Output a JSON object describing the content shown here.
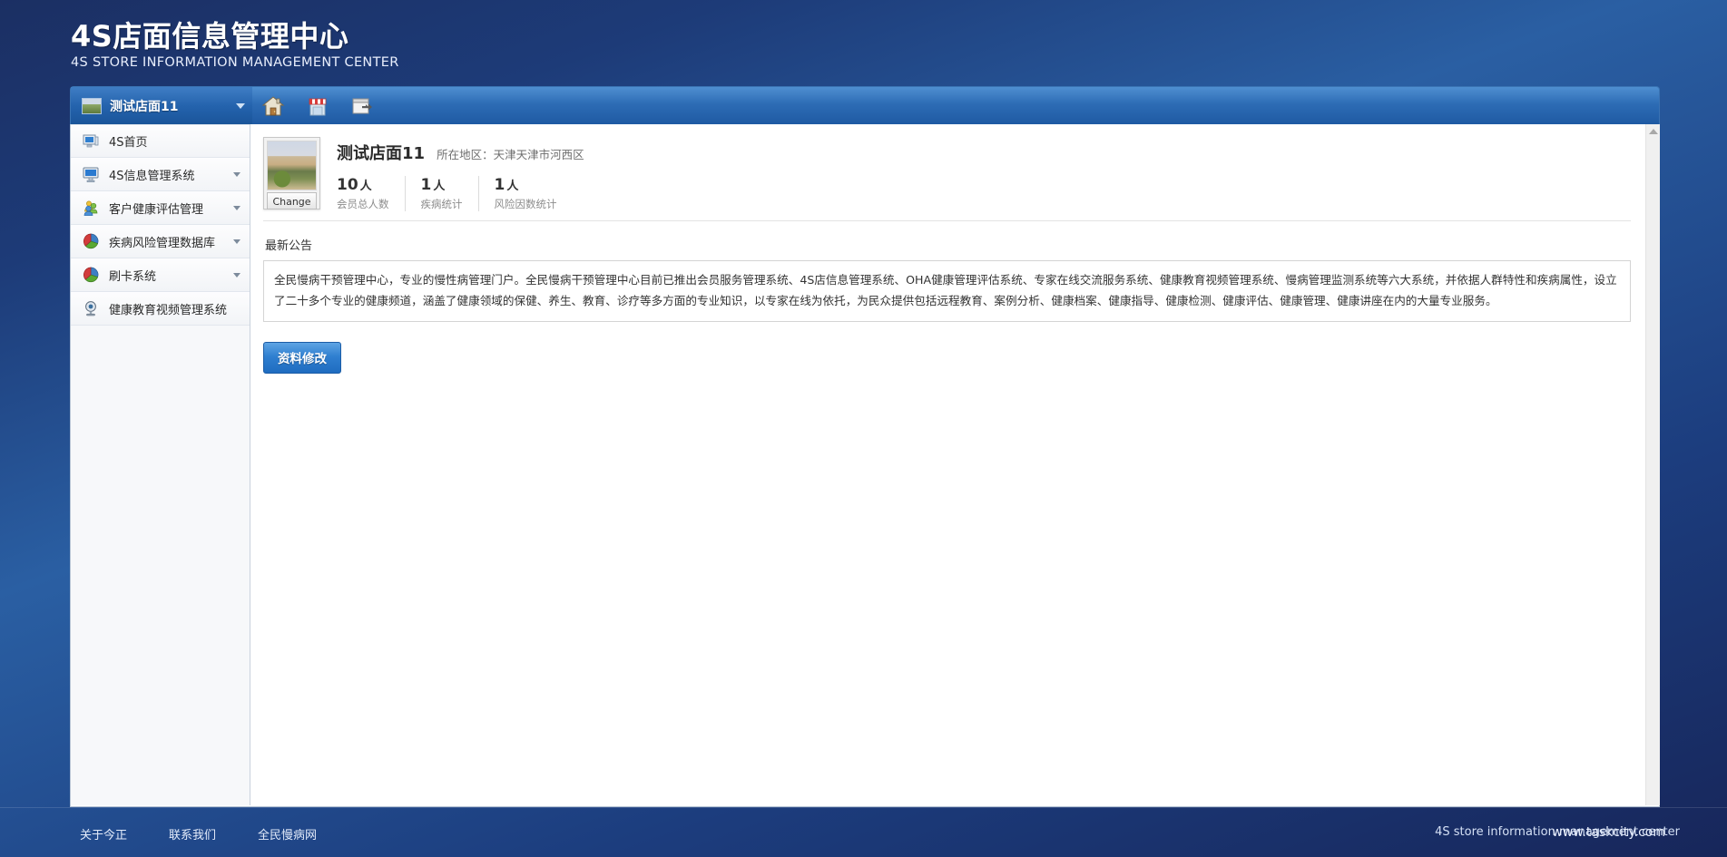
{
  "header": {
    "title_cn": "4S店面信息管理中心",
    "title_en": "4S STORE INFORMATION MANAGEMENT CENTER"
  },
  "topbar": {
    "store_selector": {
      "label": "测试店面11",
      "caret": "chevron-down-icon",
      "thumb": "store-thumbnail"
    },
    "icons": [
      {
        "name": "home-icon",
        "title": "首页"
      },
      {
        "name": "store-icon",
        "title": "店面"
      },
      {
        "name": "logout-icon",
        "title": "退出"
      }
    ]
  },
  "sidebar": {
    "items": [
      {
        "label": "4S首页",
        "icon": "monitor-icon",
        "has_caret": false
      },
      {
        "label": "4S信息管理系统",
        "icon": "screen-icon",
        "has_caret": true
      },
      {
        "label": "客户健康评估管理",
        "icon": "users-icon",
        "has_caret": true
      },
      {
        "label": "疾病风险管理数据库",
        "icon": "piechart-icon",
        "has_caret": true
      },
      {
        "label": "刷卡系统",
        "icon": "piechart-icon",
        "has_caret": true
      },
      {
        "label": "健康教育视频管理系统",
        "icon": "webcam-icon",
        "has_caret": false
      }
    ]
  },
  "content": {
    "profile": {
      "avatar_change_label": "Change",
      "store_name": "测试店面11",
      "region_label": "所在地区：天津天津市河西区",
      "stats": [
        {
          "value": "10",
          "unit": "人",
          "label": "会员总人数"
        },
        {
          "value": "1",
          "unit": "人",
          "label": "疾病统计"
        },
        {
          "value": "1",
          "unit": "人",
          "label": "风险因数统计"
        }
      ]
    },
    "announcement": {
      "title": "最新公告",
      "body": "全民慢病干预管理中心，专业的慢性病管理门户。全民慢病干预管理中心目前已推出会员服务管理系统、4S店信息管理系统、OHA健康管理评估系统、专家在线交流服务系统、健康教育视频管理系统、慢病管理监测系统等六大系统，并依据人群特性和疾病属性，设立了二十多个专业的健康频道，涵盖了健康领域的保健、养生、教育、诊疗等多方面的专业知识，以专家在线为依托，为民众提供包括远程教育、案例分析、健康档案、健康指导、健康检测、健康评估、健康管理、健康讲座在内的大量专业服务。"
    },
    "edit_button_label": "资料修改"
  },
  "footer": {
    "links": [
      "关于今正",
      "联系我们",
      "全民慢病网"
    ],
    "english": "4S store information management center",
    "url": "www.taskcity.com"
  },
  "colors": {
    "brand_blue": "#1f5aa3",
    "accent_button": "#2f7fd0",
    "page_bg": "#1d3b78"
  }
}
